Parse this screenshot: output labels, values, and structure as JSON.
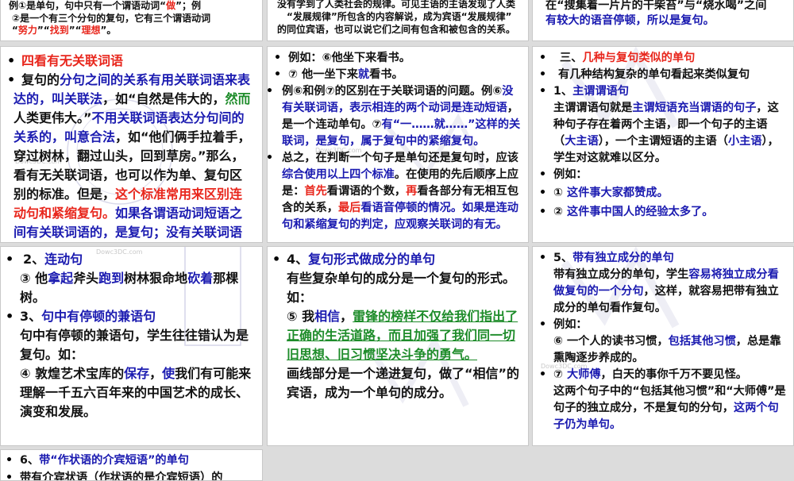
{
  "slides": {
    "s1": {
      "top_1": [
        [
          "例①是单句，句中只有一个谓语动词“",
          "k"
        ],
        [
          "做",
          "r"
        ],
        [
          "”；例",
          "k"
        ]
      ],
      "top_2": [
        [
          "②是一个有三个分句的复句，它有三个谓语动词",
          "k"
        ]
      ],
      "top_3": [
        [
          "“",
          "k"
        ],
        [
          "努力",
          "r"
        ],
        [
          "”“",
          "k"
        ],
        [
          "找到",
          "r"
        ],
        [
          "”“",
          "k"
        ],
        [
          "理想",
          "r"
        ],
        [
          "”。",
          "k"
        ]
      ],
      "heading": [
        [
          "四看有无关联词语",
          "r"
        ]
      ],
      "body": [
        [
          "复句的",
          "k"
        ],
        [
          "分句之间的关系有用关联词语来表达的，叫关联法",
          "b"
        ],
        [
          "，如“自然是伟大的，",
          "k"
        ],
        [
          "然而",
          "g"
        ],
        [
          "人类更伟大。”",
          "k"
        ],
        [
          "不用关联词语表达分句间的关系的，叫意合法",
          "b"
        ],
        [
          "，如“他们俩手拉着手，穿过树林，翻过山头，回到草房。”那么，看有无关联词语，也可以作为单、复句区别的标准。但是，",
          "k"
        ],
        [
          "这个标准常用来区别连动句和紧缩复句。",
          "r"
        ],
        [
          "如果各谓语动词短语之间有关联词语的，是复句；没有关联词语的，是单句。",
          "b"
        ]
      ]
    },
    "s2": {
      "top_1": [
        [
          "没有学到了人类社会的规律。可见主语的主语发现了人类历史的发展规律”，后面这些语言是对宾语",
          "k"
        ]
      ],
      "top_2": [
        [
          "“发展规律”所包含的内容解说，成为宾语“发展规律”",
          "k"
        ]
      ],
      "top_3": [
        [
          "的同位宾语，也可以说它们之间有包含和被包含的关系。",
          "k"
        ]
      ],
      "p1": [
        [
          "例如：⑥他坐下来看书。",
          "k"
        ]
      ],
      "p2": [
        [
          "⑦ 他一坐下来",
          "k"
        ],
        [
          "就",
          "b"
        ],
        [
          "看书。",
          "k"
        ]
      ],
      "p3": [
        [
          "例⑥和例⑦的区别在于关联词语的问题。例⑥",
          "k"
        ],
        [
          "没有关联词语，表示相连的两个动词是连动短语",
          "b"
        ],
        [
          "，是一个连动单句。⑦",
          "k"
        ],
        [
          "有“一……就……”这样的关联词，是复句，属于复句中的紧缩复句。",
          "b"
        ]
      ],
      "p4": [
        [
          "总之，在判断一个句子是单句还是复句时，应该",
          "k"
        ],
        [
          "综合使用以上四个标准",
          "b"
        ],
        [
          "。在使用的先后顺序上应是：",
          "k"
        ],
        [
          "首先",
          "r"
        ],
        [
          "看谓语的个数，",
          "k"
        ],
        [
          "再",
          "r"
        ],
        [
          "看各部分有无相互包含的关系，",
          "k"
        ],
        [
          "最后",
          "r"
        ],
        [
          "看语音停顿的情况。如果是连动句和紧缩复句的判定，应观察关联词的有无。",
          "b"
        ]
      ]
    },
    "s3": {
      "top_1": [
        [
          "在“搜集着一片片的干柴苔”与“烧水喝”之间",
          "k"
        ]
      ],
      "top_2": [
        [
          "有较大的语音停顿，所以是复句。",
          "b"
        ]
      ],
      "heading": [
        [
          "三、",
          "k"
        ],
        [
          "几种与复句类似的单句",
          "r"
        ]
      ],
      "p1": [
        [
          "有几种结构复杂的单句看起来类似复句",
          "k"
        ]
      ],
      "p2": [
        [
          "1、",
          "k"
        ],
        [
          "主谓谓语句",
          "b"
        ]
      ],
      "p3": [
        [
          "主谓谓语句就是",
          "k"
        ],
        [
          "主谓短语充当谓语的句子",
          "b"
        ],
        [
          "，这种句子存在着两个主语，即一个句子的主语（",
          "k"
        ],
        [
          "大主语",
          "b"
        ],
        [
          "），一个主谓短语的主语（",
          "k"
        ],
        [
          "小主语",
          "b"
        ],
        [
          "），学生对这就难以区分。",
          "k"
        ]
      ],
      "p4": [
        [
          "例如：",
          "k"
        ]
      ],
      "p5": [
        [
          "① ",
          "k"
        ],
        [
          "这件事大家都赞成。",
          "b"
        ]
      ],
      "p6": [
        [
          "② ",
          "k"
        ],
        [
          "这件事中国人的经验太多了。",
          "b"
        ]
      ]
    },
    "s4": {
      "p1": [
        [
          "2、",
          "k"
        ],
        [
          "连动句",
          "b"
        ]
      ],
      "p2": [
        [
          "③ 他",
          "k"
        ],
        [
          "拿起",
          "b"
        ],
        [
          "斧头",
          "k"
        ],
        [
          "跑到",
          "b"
        ],
        [
          "树林狠命地",
          "k"
        ],
        [
          "砍着",
          "b"
        ],
        [
          "那棵树。",
          "k"
        ]
      ],
      "p3": [
        [
          "3、",
          "k"
        ],
        [
          "句中有停顿的兼语句",
          "b"
        ]
      ],
      "p4": [
        [
          "句中有停顿的兼语句，学生往往错认为是复句。如：",
          "k"
        ]
      ],
      "p5": [
        [
          "④ 敦煌艺术宝库的",
          "k"
        ],
        [
          "保存",
          "b"
        ],
        [
          "，",
          "k"
        ],
        [
          "使",
          "b"
        ],
        [
          "我们有可能来理解一千五六百年来的中国艺术的成长、演变和发展。",
          "k"
        ]
      ]
    },
    "s5": {
      "p1": [
        [
          "4、",
          "k"
        ],
        [
          "复句形式做成分的单句",
          "b"
        ]
      ],
      "p2": [
        [
          "有些复杂单句的成分是一个复句的形式。如：",
          "k"
        ]
      ],
      "p3": [
        [
          "⑤ 我",
          "k"
        ],
        [
          "相信",
          "b"
        ],
        [
          "，",
          "k"
        ],
        [
          "雷锋的榜样不仅给我们指出了正确的生活道路，而且加强了我们同一切旧思想、旧习惯坚决斗争的勇气。",
          "gu"
        ]
      ],
      "p4": [
        [
          "画线部分是一个递进复句，做了“相信”的宾语，成为一个单句的成分。",
          "k"
        ]
      ]
    },
    "s6": {
      "p1": [
        [
          "5、",
          "k"
        ],
        [
          "带有独立成分的单句",
          "b"
        ]
      ],
      "p2": [
        [
          "带有独立成分的单句，学生",
          "k"
        ],
        [
          "容易将独立成分看做复句的一个分句",
          "b"
        ],
        [
          "，这样，就容易把带有独立成分的单句看作复句。",
          "k"
        ]
      ],
      "p3": [
        [
          "例如：",
          "k"
        ]
      ],
      "p4": [
        [
          "⑥ 一个人的读书习惯，",
          "k"
        ],
        [
          "包括其他习惯",
          "b"
        ],
        [
          "，总是靠熏陶逐步养成的。",
          "k"
        ]
      ],
      "p5": [
        [
          "⑦ ",
          "k"
        ],
        [
          "大师傅",
          "b"
        ],
        [
          "，白天的事你千万不要见怪。",
          "k"
        ]
      ],
      "p6": [
        [
          "这两个句子中的“包括其他习惯”和“大师傅”是句子的独立成分，不是复句的分句，",
          "k"
        ],
        [
          "这两个句子仍为单句。",
          "b"
        ]
      ]
    },
    "s7": {
      "p1": [
        [
          "6、",
          "k"
        ],
        [
          "带“作状语的介宾短语”的单句",
          "b"
        ]
      ],
      "p2": [
        [
          "带有介宾状语（作状语的是介宾短语）的",
          "k"
        ]
      ]
    }
  },
  "watermark": "Dowc3DC.com",
  "colors": {
    "black": "#111111",
    "blue": "#1a1ab0",
    "red": "#e8261c",
    "green": "#1e8c2a",
    "deco": "#b9b9d8"
  }
}
